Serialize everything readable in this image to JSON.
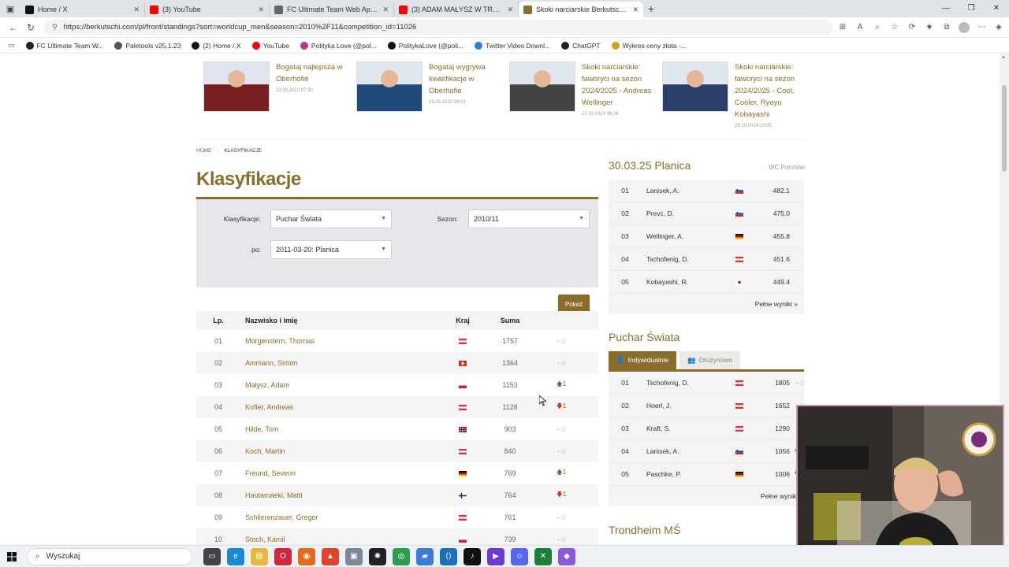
{
  "browser": {
    "tabs": [
      {
        "title": "Home / X",
        "icon": "x-icon",
        "color": "#111111",
        "active": false
      },
      {
        "title": "(3) YouTube",
        "icon": "youtube-icon",
        "color": "#ff0000",
        "active": false
      },
      {
        "title": "FC Ultimate Team Web App - EA",
        "icon": "ea-icon",
        "color": "#666666",
        "active": false
      },
      {
        "title": "(3) ADAM MAŁYSZ W TRONDHE",
        "icon": "youtube-icon",
        "color": "#ff0000",
        "active": false
      },
      {
        "title": "Skoki narciarskie Berkutschi.com",
        "icon": "skijump-icon",
        "color": "#8b6d2a",
        "active": true
      }
    ],
    "url": "https://berkutschi.com/pl/front/standings?sort=worldcup_men&season=2010%2F11&competition_id=11026",
    "bookmarks": [
      {
        "label": "FC Ultimate Team W...",
        "icon": "ea-icon",
        "color": "#222222"
      },
      {
        "label": "Paletools v25.1.23",
        "icon": "globe-icon",
        "color": "#555555"
      },
      {
        "label": "(2) Home / X",
        "icon": "x-icon",
        "color": "#111111"
      },
      {
        "label": "YouTube",
        "icon": "youtube-icon",
        "color": "#ff0000"
      },
      {
        "label": "Polityka Love (@pol...",
        "icon": "instagram-icon",
        "color": "#c13584"
      },
      {
        "label": "PolitykaLove (@poli...",
        "icon": "tiktok-icon",
        "color": "#111111"
      },
      {
        "label": "Twitter Video Downl...",
        "icon": "download-icon",
        "color": "#2a7de1"
      },
      {
        "label": "ChatGPT",
        "icon": "chatgpt-icon",
        "color": "#222222"
      },
      {
        "label": "Wykres ceny złota -...",
        "icon": "gold-icon",
        "color": "#d4a017"
      }
    ]
  },
  "news": [
    {
      "title": "Bogataj najlepsza w Oberhofie",
      "date": "13.03.2022 07:30",
      "tone": "#7a1f1f"
    },
    {
      "title": "Bogataj wygrywa kwalifikacje w Oberhofie",
      "date": "13.03.2022 08:02",
      "tone": "#1f4a7a"
    },
    {
      "title": "Skoki narciarskie: faworyci na sezon 2024/2025 - Andreas Wellinger",
      "date": "27.10.2024 08:24",
      "tone": "#444444"
    },
    {
      "title": "Skoki narciarskie: faworyci na sezon 2024/2025 - Cool, Cooler, Ryoyu Kobayashi",
      "date": "26.10.2024 13:05",
      "tone": "#2a3f6a"
    }
  ],
  "breadcrumb": {
    "home": "HOME",
    "sep": "/",
    "current": "KLASYFIKACJE"
  },
  "page_title": "Klasyfikacje",
  "filters": {
    "klasyfikacje_label": "Klasyfikacje:",
    "klasyfikacje_value": "Puchar Świata",
    "sezon_label": "Sezon:",
    "sezon_value": "2010/11",
    "po_label": "po:",
    "po_value": "2011-03-20: Planica",
    "submit": "Pokaż"
  },
  "table": {
    "headers": {
      "lp": "Lp.",
      "name": "Nazwisko i imię",
      "kraj": "Kraj",
      "suma": "Suma"
    },
    "rows": [
      {
        "lp": "01",
        "name": "Morgenstern, Thomas",
        "flag": "AUT",
        "suma": "1757",
        "dir": "none",
        "chg": "0"
      },
      {
        "lp": "02",
        "name": "Ammann, Simon",
        "flag": "SUI",
        "suma": "1364",
        "dir": "none",
        "chg": "0"
      },
      {
        "lp": "03",
        "name": "Malysz, Adam",
        "flag": "POL",
        "suma": "1153",
        "dir": "up",
        "chg": "1"
      },
      {
        "lp": "04",
        "name": "Kofler, Andreas",
        "flag": "AUT",
        "suma": "1128",
        "dir": "down",
        "chg": "1"
      },
      {
        "lp": "05",
        "name": "Hilde, Tom",
        "flag": "NOR",
        "suma": "903",
        "dir": "none",
        "chg": "0"
      },
      {
        "lp": "06",
        "name": "Koch, Martin",
        "flag": "AUT",
        "suma": "840",
        "dir": "none",
        "chg": "0"
      },
      {
        "lp": "07",
        "name": "Freund, Severin",
        "flag": "GER",
        "suma": "769",
        "dir": "up",
        "chg": "1"
      },
      {
        "lp": "08",
        "name": "Hautamaeki, Matti",
        "flag": "FIN",
        "suma": "764",
        "dir": "down",
        "chg": "1"
      },
      {
        "lp": "09",
        "name": "Schlierenzauer, Gregor",
        "flag": "AUT",
        "suma": "761",
        "dir": "none",
        "chg": "0"
      },
      {
        "lp": "10",
        "name": "Stoch, Kamil",
        "flag": "POL",
        "suma": "739",
        "dir": "none",
        "chg": "0"
      }
    ]
  },
  "side_event": {
    "title": "30.03.25 Planica",
    "subtitle": "WC Panowie",
    "rows": [
      {
        "lp": "01",
        "name": "Lanisek, A.",
        "flag": "SLO",
        "pts": "482.1"
      },
      {
        "lp": "02",
        "name": "Prevc, D.",
        "flag": "SLO",
        "pts": "475.0"
      },
      {
        "lp": "03",
        "name": "Wellinger, A.",
        "flag": "GER",
        "pts": "455.8"
      },
      {
        "lp": "04",
        "name": "Tschofenig, D.",
        "flag": "AUT",
        "pts": "451.6"
      },
      {
        "lp": "05",
        "name": "Kobayashi, R.",
        "flag": "JPN",
        "pts": "449.4"
      }
    ],
    "more": "Pełne wyniki »"
  },
  "side_wc": {
    "title": "Puchar Świata",
    "tab_individual": "Indywidualnie",
    "tab_team": "Drużynowo",
    "rows": [
      {
        "lp": "01",
        "name": "Tschofenig, D.",
        "flag": "AUT",
        "pts": "1805",
        "dir": "none",
        "chg": "0"
      },
      {
        "lp": "02",
        "name": "Hoerl, J.",
        "flag": "AUT",
        "pts": "1652",
        "dir": "none",
        "chg": "0"
      },
      {
        "lp": "03",
        "name": "Kraft, S.",
        "flag": "AUT",
        "pts": "1290",
        "dir": "none",
        "chg": "0"
      },
      {
        "lp": "04",
        "name": "Lanisek, A.",
        "flag": "SLO",
        "pts": "1056",
        "dir": "up",
        "chg": "2"
      },
      {
        "lp": "05",
        "name": "Paschke, P.",
        "flag": "GER",
        "pts": "1006",
        "dir": "down",
        "chg": "1"
      }
    ],
    "more": "Pełne wyniki"
  },
  "side_next": {
    "title": "Trondheim MŚ"
  },
  "taskbar": {
    "search_placeholder": "Wyszukaj"
  },
  "colors": {
    "accent": "#8b6d2a",
    "up": "#3a8d2f",
    "down": "#c0392b"
  }
}
